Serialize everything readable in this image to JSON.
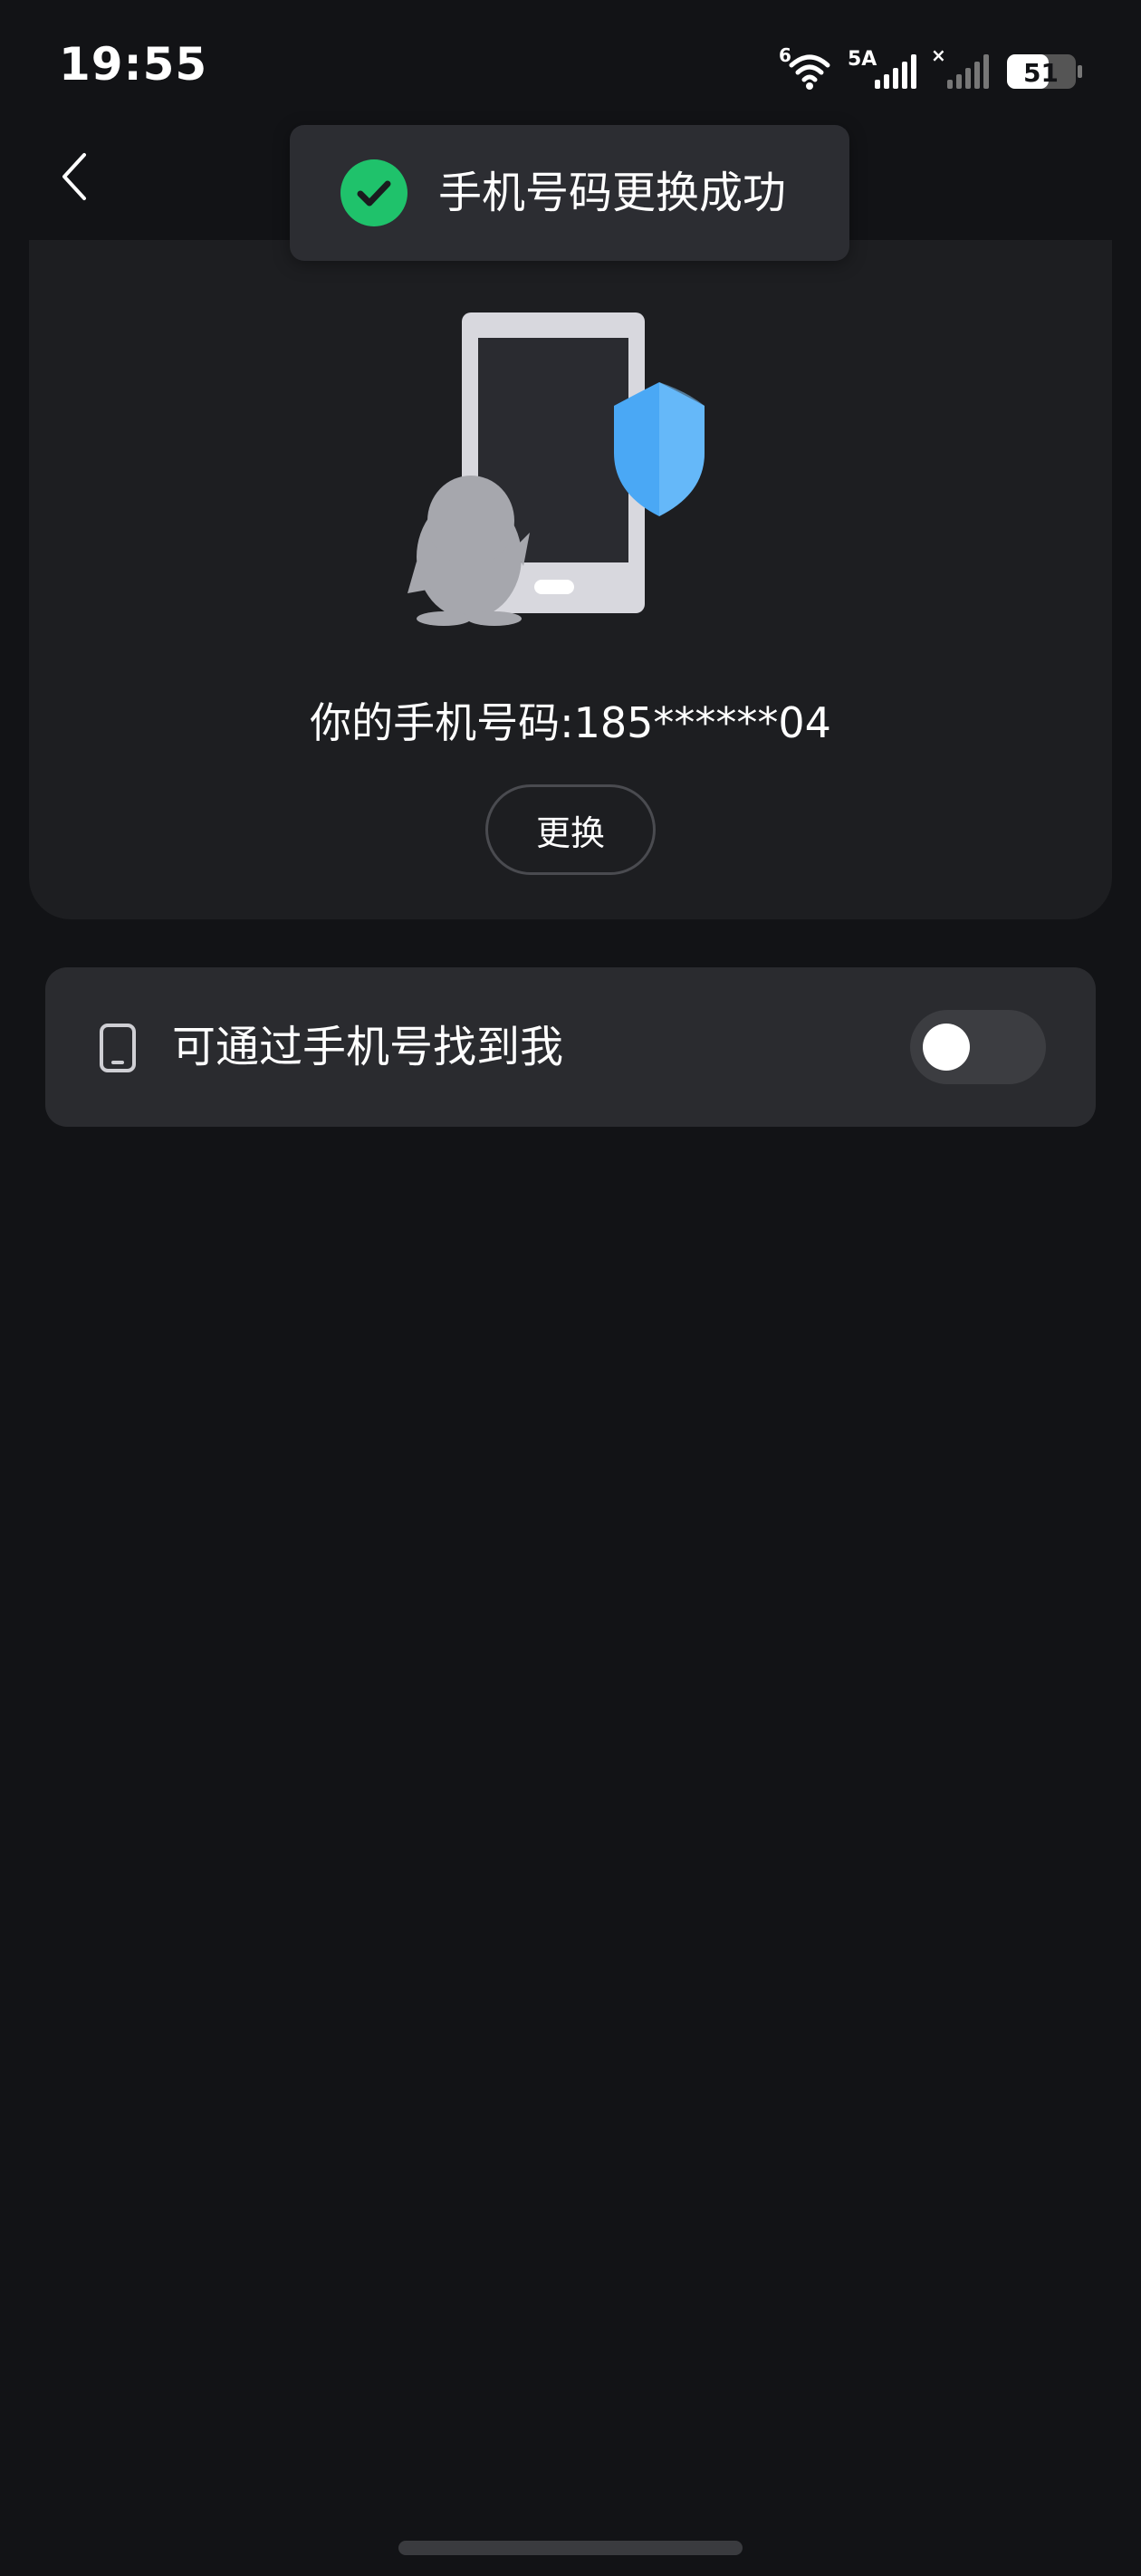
{
  "status_bar": {
    "time": "19:55",
    "wifi_badge": "6",
    "network_label": "5A",
    "battery": "51"
  },
  "toast": {
    "message": "手机号码更换成功",
    "icon": "check-circle-icon",
    "accent": "#1fc26b"
  },
  "nav": {
    "back_icon": "chevron-left-icon"
  },
  "phone_card": {
    "illustration": "phone-shield-penguin-illustration",
    "phone_text": "你的手机号码:185******04",
    "change_button_label": "更换"
  },
  "settings": {
    "find_by_phone": {
      "icon": "phone-icon",
      "label": "可通过手机号找到我",
      "enabled": false
    }
  },
  "colors": {
    "background": "#121316",
    "card": "#1d1e21",
    "row": "#2a2b2f",
    "shield": "#4aa8f5"
  }
}
